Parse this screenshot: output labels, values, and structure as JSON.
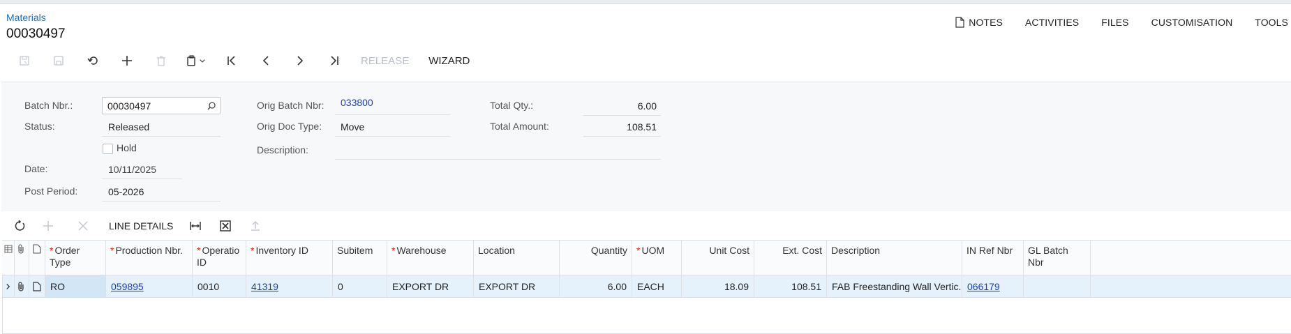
{
  "breadcrumb": "Materials",
  "doc_title": "00030497",
  "top_actions": [
    {
      "label": "NOTES",
      "icon": "note-icon"
    },
    {
      "label": "ACTIVITIES"
    },
    {
      "label": "FILES"
    },
    {
      "label": "CUSTOMISATION"
    },
    {
      "label": "TOOLS"
    }
  ],
  "toolbar": {
    "release_label": "RELEASE",
    "wizard_label": "WIZARD"
  },
  "form": {
    "batch_nbr_label": "Batch Nbr.:",
    "batch_nbr_value": "00030497",
    "status_label": "Status:",
    "status_value": "Released",
    "hold_label": "Hold",
    "date_label": "Date:",
    "date_value": "10/11/2025",
    "post_period_label": "Post Period:",
    "post_period_value": "05-2026",
    "orig_batch_label": "Orig Batch Nbr:",
    "orig_batch_value": "033800",
    "orig_doc_type_label": "Orig Doc Type:",
    "orig_doc_type_value": "Move",
    "description_label": "Description:",
    "description_value": "",
    "total_qty_label": "Total Qty.:",
    "total_qty_value": "6.00",
    "total_amount_label": "Total Amount:",
    "total_amount_value": "108.51"
  },
  "grid_toolbar": {
    "line_details_label": "LINE DETAILS"
  },
  "grid": {
    "headers": {
      "order_type": "Order Type",
      "production_nbr": "Production Nbr.",
      "operation_id": "Operatio ID",
      "inventory_id": "Inventory ID",
      "subitem": "Subitem",
      "warehouse": "Warehouse",
      "location": "Location",
      "quantity": "Quantity",
      "uom": "UOM",
      "unit_cost": "Unit Cost",
      "ext_cost": "Ext. Cost",
      "description": "Description",
      "in_ref_nbr": "IN Ref Nbr",
      "gl_batch_nbr": "GL Batch Nbr"
    },
    "rows": [
      {
        "order_type": "RO",
        "production_nbr": "059895",
        "operation_id": "0010",
        "inventory_id": "41319",
        "subitem": "0",
        "warehouse": "EXPORT DR",
        "location": "EXPORT DR",
        "quantity": "6.00",
        "uom": "EACH",
        "unit_cost": "18.09",
        "ext_cost": "108.51",
        "description": "FAB Freestanding Wall Vertic...",
        "in_ref_nbr": "066179",
        "gl_batch_nbr": ""
      }
    ]
  },
  "colors": {
    "accent_link": "#1a3fb0",
    "breadcrumb": "#1a6fc2",
    "row_selected": "#e6f2fb",
    "required_mark": "#dd2222"
  }
}
